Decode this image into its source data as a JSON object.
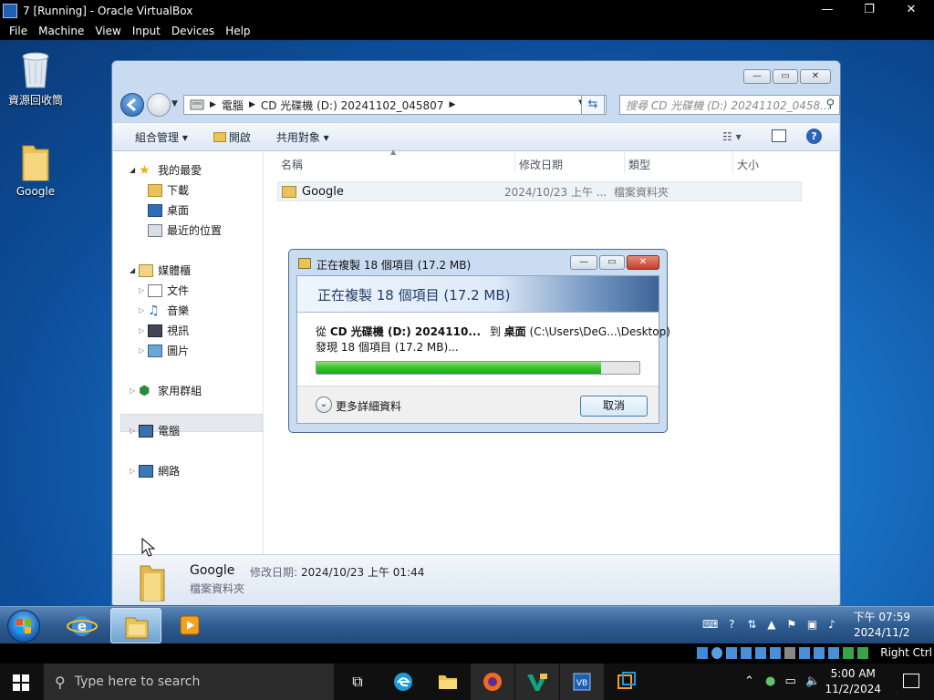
{
  "host_window": {
    "title": "7 [Running] - Oracle VirtualBox",
    "controls": {
      "minimize": "—",
      "maximize": "❐",
      "close": "✕"
    },
    "menu": [
      "File",
      "Machine",
      "View",
      "Input",
      "Devices",
      "Help"
    ]
  },
  "desktop": {
    "icons": [
      {
        "label": "資源回收筒",
        "icon": "recycle-bin-icon"
      },
      {
        "label": "Google",
        "icon": "folder-icon"
      }
    ]
  },
  "explorer": {
    "address": {
      "segments": [
        "電腦",
        "CD 光碟機 (D:) 20241102_045807"
      ]
    },
    "search_placeholder": "搜尋 CD 光碟機 (D:) 20241102_0458...",
    "toolbar": {
      "organize": "組合管理 ▾",
      "open": "開啟",
      "share": "共用對象 ▾"
    },
    "nav": {
      "favorites": "我的最愛",
      "downloads": "下載",
      "desktop": "桌面",
      "recent": "最近的位置",
      "libraries": "媒體櫃",
      "documents": "文件",
      "music": "音樂",
      "videos": "視訊",
      "pictures": "圖片",
      "homegroup": "家用群組",
      "computer": "電腦",
      "network": "網路"
    },
    "columns": {
      "name": "名稱",
      "modified": "修改日期",
      "type": "類型",
      "size": "大小"
    },
    "rows": [
      {
        "name": "Google",
        "modified": "2024/10/23 上午 ...",
        "type": "檔案資料夾",
        "size": ""
      }
    ],
    "details": {
      "name": "Google",
      "modified_label": "修改日期:",
      "modified_value": "2024/10/23 上午 01:44",
      "type": "檔案資料夾"
    }
  },
  "copy_dialog": {
    "title": "正在複製 18 個項目 (17.2 MB)",
    "heading": "正在複製 18 個項目 (17.2 MB)",
    "from_prefix": "從",
    "from_source": "CD 光碟機 (D:) 2024110...",
    "to_prefix": "到",
    "to_target": "桌面",
    "to_path": "(C:\\Users\\DeG...\\Desktop)",
    "status": "發現 18 個項目 (17.2 MB)...",
    "progress_percent": 88,
    "more_details": "更多詳細資料",
    "cancel": "取消"
  },
  "guest_taskbar": {
    "time": "下午 07:59",
    "date": "2024/11/2"
  },
  "vbox_status": {
    "host_key": "Right Ctrl"
  },
  "host_taskbar": {
    "search_placeholder": "Type here to search",
    "time": "5:00 AM",
    "date": "11/2/2024"
  }
}
